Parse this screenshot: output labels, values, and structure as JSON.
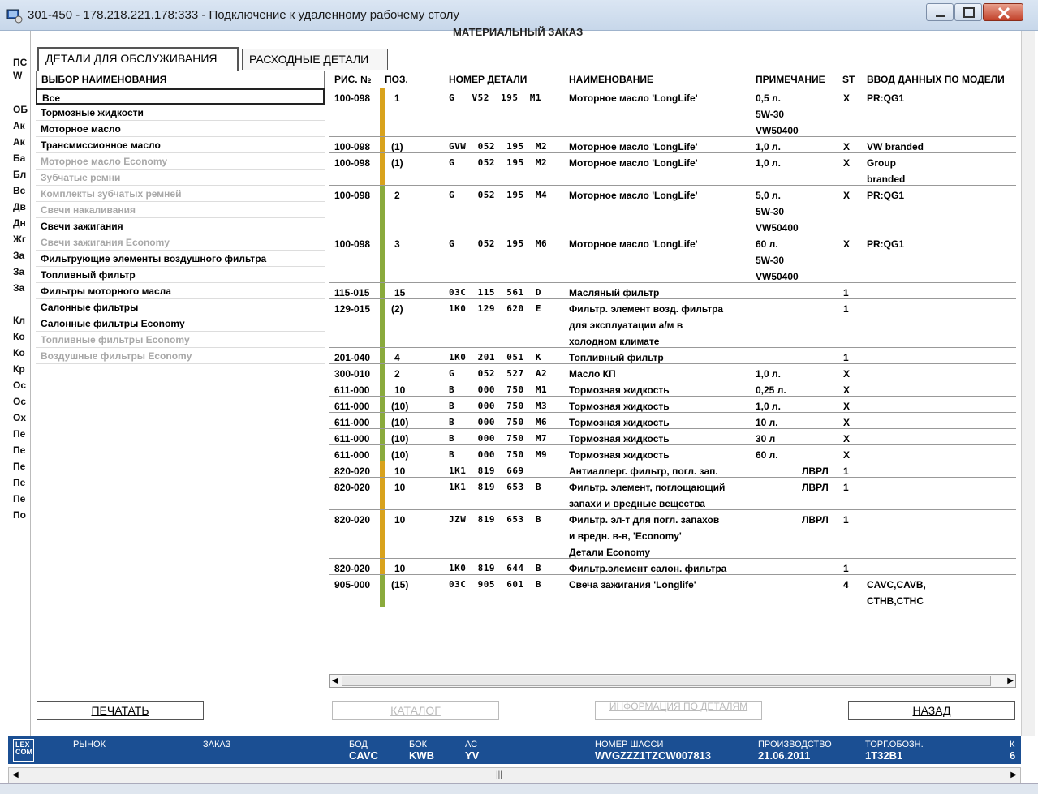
{
  "window": {
    "title": "301-450 - 178.218.221.178:333 - Подключение к удаленному рабочему столу"
  },
  "bg_left": [
    "ПС",
    "W",
    "ОБ",
    "Ак",
    "Ак",
    "Ба",
    "Бл",
    "Вс",
    "Дв",
    "Дн",
    "Жг",
    "За",
    "За",
    "За",
    "Кл",
    "Ко",
    "Ко",
    "Кр",
    "Ос",
    "Ос",
    "Ох",
    "Пе",
    "Пе",
    "Пе",
    "Пе",
    "Пе",
    "По"
  ],
  "panel": {
    "header": "МАТЕРИАЛЬНЫЙ ЗАКАЗ",
    "tabs": [
      "ДЕТАЛИ ДЛЯ ОБСЛУЖИВАНИЯ",
      "РАСХОДНЫЕ ДЕТАЛИ"
    ]
  },
  "left": {
    "header": "ВЫБОР НАИМЕНОВАНИЯ",
    "items": [
      {
        "label": "Все",
        "state": "selected"
      },
      {
        "label": "Тормозные жидкости",
        "state": "enabled"
      },
      {
        "label": "Моторное масло",
        "state": "enabled"
      },
      {
        "label": "Трансмиссионное масло",
        "state": "enabled"
      },
      {
        "label": "Моторное масло Economy",
        "state": "disabled"
      },
      {
        "label": "Зубчатые ремни",
        "state": "disabled"
      },
      {
        "label": "Комплекты зубчатых ремней",
        "state": "disabled"
      },
      {
        "label": "Свечи накаливания",
        "state": "disabled"
      },
      {
        "label": "Свечи зажигания",
        "state": "enabled"
      },
      {
        "label": "Свечи зажигания Economy",
        "state": "disabled"
      },
      {
        "label": "Фильтрующие элементы воздушного фильтра",
        "state": "enabled"
      },
      {
        "label": "Топливный фильтр",
        "state": "enabled"
      },
      {
        "label": "Фильтры моторного масла",
        "state": "enabled"
      },
      {
        "label": "Салонные фильтры",
        "state": "enabled"
      },
      {
        "label": "Салонные фильтры Economy",
        "state": "enabled"
      },
      {
        "label": "Топливные фильтры Economy",
        "state": "disabled"
      },
      {
        "label": "Воздушные фильтры Economy",
        "state": "disabled"
      }
    ]
  },
  "table": {
    "headers": [
      "РИС. №",
      "ПОЗ.",
      "НОМЕР ДЕТАЛИ",
      "НАИМЕНОВАНИЕ",
      "ПРИМЕЧАНИЕ",
      "ST",
      "ВВОД ДАННЫХ ПО МОДЕЛИ"
    ],
    "colors": {
      "orange": "#d8a21c",
      "green": "#8aaa3c"
    },
    "rows": [
      {
        "fig": "100-098",
        "pos": "1",
        "part": "G   V52  195  M1",
        "name": "Моторное масло 'LongLife'",
        "note": "0,5 л.\n5W-30\nVW50400",
        "st": "X",
        "model": "PR:QG1",
        "bar": "orange",
        "lines": 3
      },
      {
        "fig": "100-098",
        "pos": "(1)",
        "part": "GVW  052  195  M2",
        "name": "Моторное масло 'LongLife'",
        "note": "1,0 л.",
        "st": "X",
        "model": "VW branded",
        "bar": "orange",
        "lines": 1
      },
      {
        "fig": "100-098",
        "pos": "(1)",
        "part": "G    052  195  M2",
        "name": "Моторное масло 'LongLife'",
        "note": "1,0 л.",
        "st": "X",
        "model": "Group\nbranded",
        "bar": "orange",
        "lines": 2
      },
      {
        "fig": "100-098",
        "pos": "2",
        "part": "G    052  195  M4",
        "name": "Моторное масло 'LongLife'",
        "note": "5,0 л.\n5W-30\nVW50400",
        "st": "X",
        "model": "PR:QG1",
        "bar": "green",
        "lines": 3
      },
      {
        "fig": "100-098",
        "pos": "3",
        "part": "G    052  195  M6",
        "name": "Моторное масло 'LongLife'",
        "note": "60 л.\n5W-30\nVW50400",
        "st": "X",
        "model": "PR:QG1",
        "bar": "green",
        "lines": 3
      },
      {
        "fig": "115-015",
        "pos": "15",
        "part": "03C  115  561  D",
        "name": "Масляный фильтр",
        "note": "",
        "st": "1",
        "model": "",
        "bar": "green",
        "lines": 1
      },
      {
        "fig": "129-015",
        "pos": "(2)",
        "part": "1K0  129  620  E",
        "name": "Фильтр. элемент возд. фильтра\nдля эксплуатации а/м в\nхолодном климате",
        "note": "",
        "st": "1",
        "model": "",
        "bar": "green",
        "lines": 3
      },
      {
        "fig": "201-040",
        "pos": "4",
        "part": "1K0  201  051  K",
        "name": "Топливный фильтр",
        "note": "",
        "st": "1",
        "model": "",
        "bar": "green",
        "lines": 1
      },
      {
        "fig": "300-010",
        "pos": "2",
        "part": "G    052  527  A2",
        "name": "Масло КП",
        "note": "1,0 л.",
        "st": "X",
        "model": "",
        "bar": "green",
        "lines": 1
      },
      {
        "fig": "611-000",
        "pos": "10",
        "part": "B    000  750  M1",
        "name": "Тормозная жидкость",
        "note": "0,25 л.",
        "st": "X",
        "model": "",
        "bar": "green",
        "lines": 1
      },
      {
        "fig": "611-000",
        "pos": "(10)",
        "part": "B    000  750  M3",
        "name": "Тормозная жидкость",
        "note": "1,0 л.",
        "st": "X",
        "model": "",
        "bar": "green",
        "lines": 1
      },
      {
        "fig": "611-000",
        "pos": "(10)",
        "part": "B    000  750  M6",
        "name": "Тормозная жидкость",
        "note": "10 л.",
        "st": "X",
        "model": "",
        "bar": "green",
        "lines": 1
      },
      {
        "fig": "611-000",
        "pos": "(10)",
        "part": "B    000  750  M7",
        "name": "Тормозная жидкость",
        "note": "30 л",
        "st": "X",
        "model": "",
        "bar": "green",
        "lines": 1
      },
      {
        "fig": "611-000",
        "pos": "(10)",
        "part": "B    000  750  M9",
        "name": "Тормозная жидкость",
        "note": "60 л.",
        "st": "X",
        "model": "",
        "bar": "green",
        "lines": 1
      },
      {
        "fig": "820-020",
        "pos": "10",
        "part": "1K1  819  669",
        "name": "Антиаллерг. фильтр, погл. зап.",
        "note": "ЛВРЛ",
        "st": "1",
        "model": "",
        "bar": "orange",
        "lines": 1
      },
      {
        "fig": "820-020",
        "pos": "10",
        "part": "1K1  819  653  B",
        "name": "Фильтр. элемент, поглощающий\nзапахи и вредные вещества",
        "note": "ЛВРЛ",
        "st": "1",
        "model": "",
        "bar": "orange",
        "lines": 2
      },
      {
        "fig": "820-020",
        "pos": "10",
        "part": "JZW  819  653  B",
        "name": "Фильтр. эл-т для погл. запахов\nи вредн. в-в, 'Economy'\nДетали Economy",
        "note": "ЛВРЛ",
        "st": "1",
        "model": "",
        "bar": "orange",
        "lines": 3
      },
      {
        "fig": "820-020",
        "pos": "10",
        "part": "1K0  819  644  B",
        "name": "Фильтр.элемент салон. фильтра",
        "note": "",
        "st": "1",
        "model": "",
        "bar": "orange",
        "lines": 1
      },
      {
        "fig": "905-000",
        "pos": "(15)",
        "part": "03C  905  601  B",
        "name": "Свеча зажигания 'Longlife'",
        "note": "",
        "st": "4",
        "model": "CAVC,CAVB,\nCTHB,CTHC",
        "bar": "green",
        "lines": 2
      }
    ]
  },
  "buttons": {
    "print": "ПЕЧАТАТЬ",
    "catalog": "КАТАЛОГ",
    "info": "ИНФОРМАЦИЯ ПО ДЕТАЛЯМ",
    "back": "НАЗАД"
  },
  "status": {
    "logo": "LEX\nCOM",
    "fields": [
      {
        "label": "РЫНОК",
        "value": ""
      },
      {
        "label": "ЗАКАЗ",
        "value": ""
      },
      {
        "label": "БОД",
        "value": "CAVC"
      },
      {
        "label": "БОК",
        "value": "KWB"
      },
      {
        "label": "АС",
        "value": "YV"
      },
      {
        "label": "НОМЕР ШАССИ",
        "value": "WVGZZZ1TZCW007813"
      },
      {
        "label": "ПРОИЗВОДСТВО",
        "value": "21.06.2011"
      },
      {
        "label": "ТОРГ.ОБОЗН.",
        "value": "1T32B1"
      },
      {
        "label": "К",
        "value": "6"
      }
    ]
  }
}
